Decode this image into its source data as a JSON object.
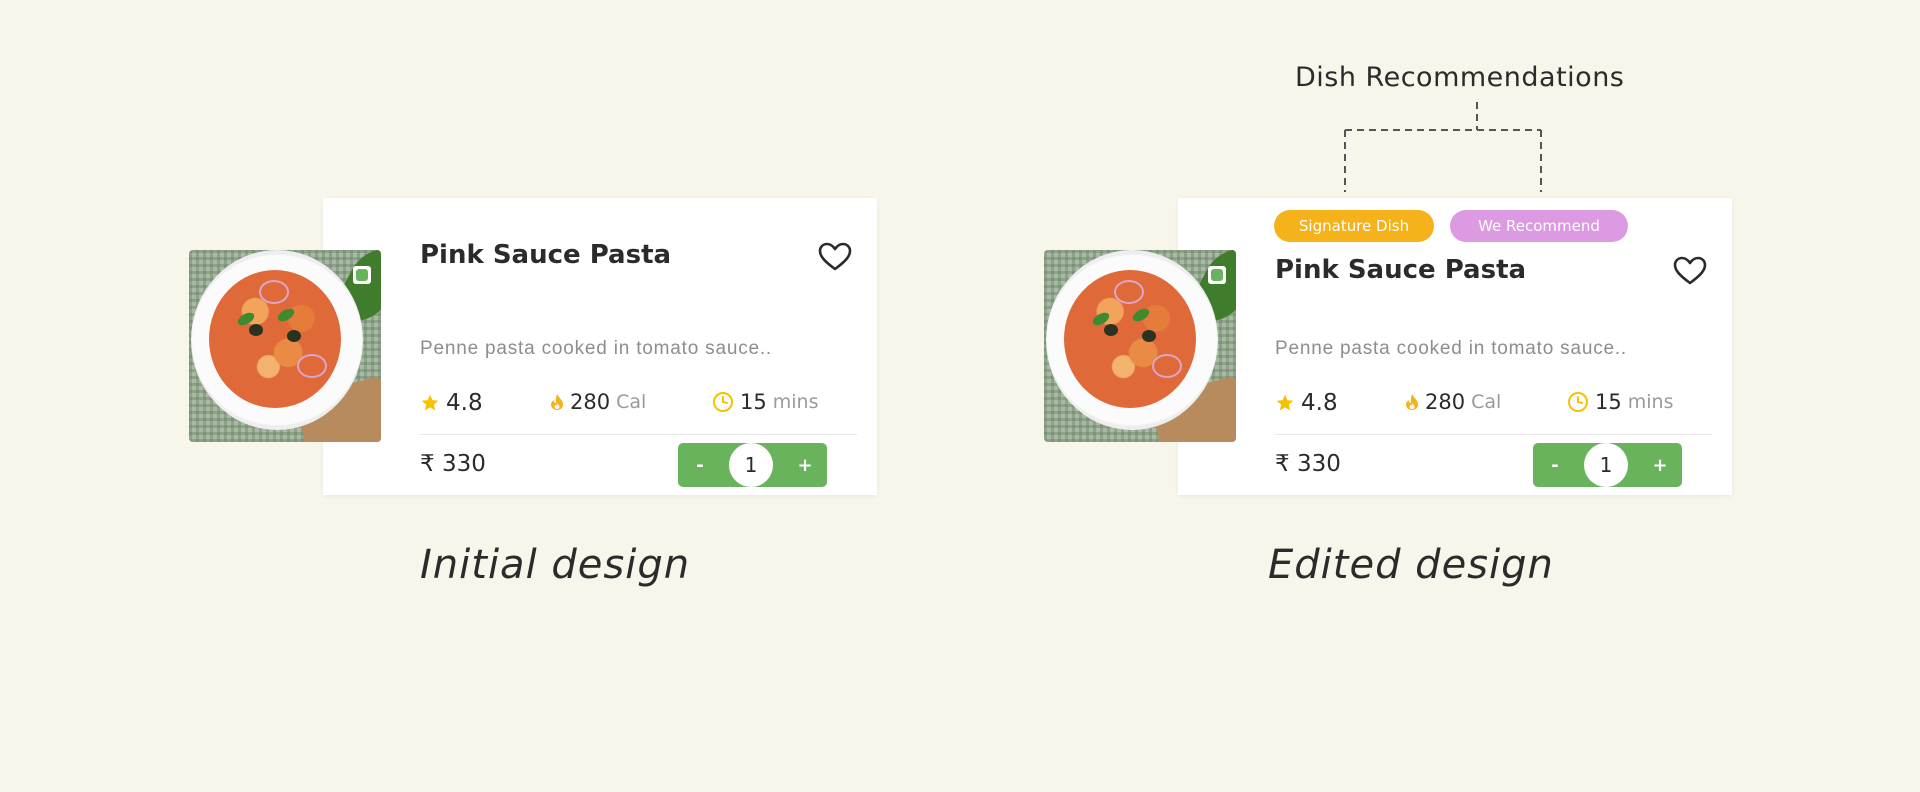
{
  "colors": {
    "background": "#f8f6ea",
    "card": "#ffffff",
    "accent_green": "#6ab35d",
    "signature_tag": "#f6b21a",
    "recommend_tag": "#dc9ae2",
    "star": "#f6c200",
    "text_dark": "#2b2b2b",
    "text_muted": "#8d8d8d"
  },
  "annotation": {
    "title": "Dish Recommendations"
  },
  "designs": [
    {
      "caption": "Initial design",
      "dish": {
        "name": "Pink Sauce Pasta",
        "description": "Penne pasta cooked in tomato sauce..",
        "rating": "4.8",
        "calories": "280",
        "calories_unit": "Cal",
        "time": "15",
        "time_unit": "mins",
        "price": "₹ 330",
        "quantity": "1",
        "minus_label": "-",
        "plus_label": "+",
        "icons": [
          "veg-icon",
          "heart-icon",
          "star-icon",
          "flame-icon",
          "clock-icon"
        ]
      }
    },
    {
      "caption": "Edited design",
      "tags": [
        "Signature Dish",
        "We Recommend"
      ],
      "dish": {
        "name": "Pink Sauce Pasta",
        "description": "Penne pasta cooked in tomato sauce..",
        "rating": "4.8",
        "calories": "280",
        "calories_unit": "Cal",
        "time": "15",
        "time_unit": "mins",
        "price": "₹ 330",
        "quantity": "1",
        "minus_label": "-",
        "plus_label": "+",
        "icons": [
          "veg-icon",
          "heart-icon",
          "star-icon",
          "flame-icon",
          "clock-icon"
        ]
      }
    }
  ]
}
